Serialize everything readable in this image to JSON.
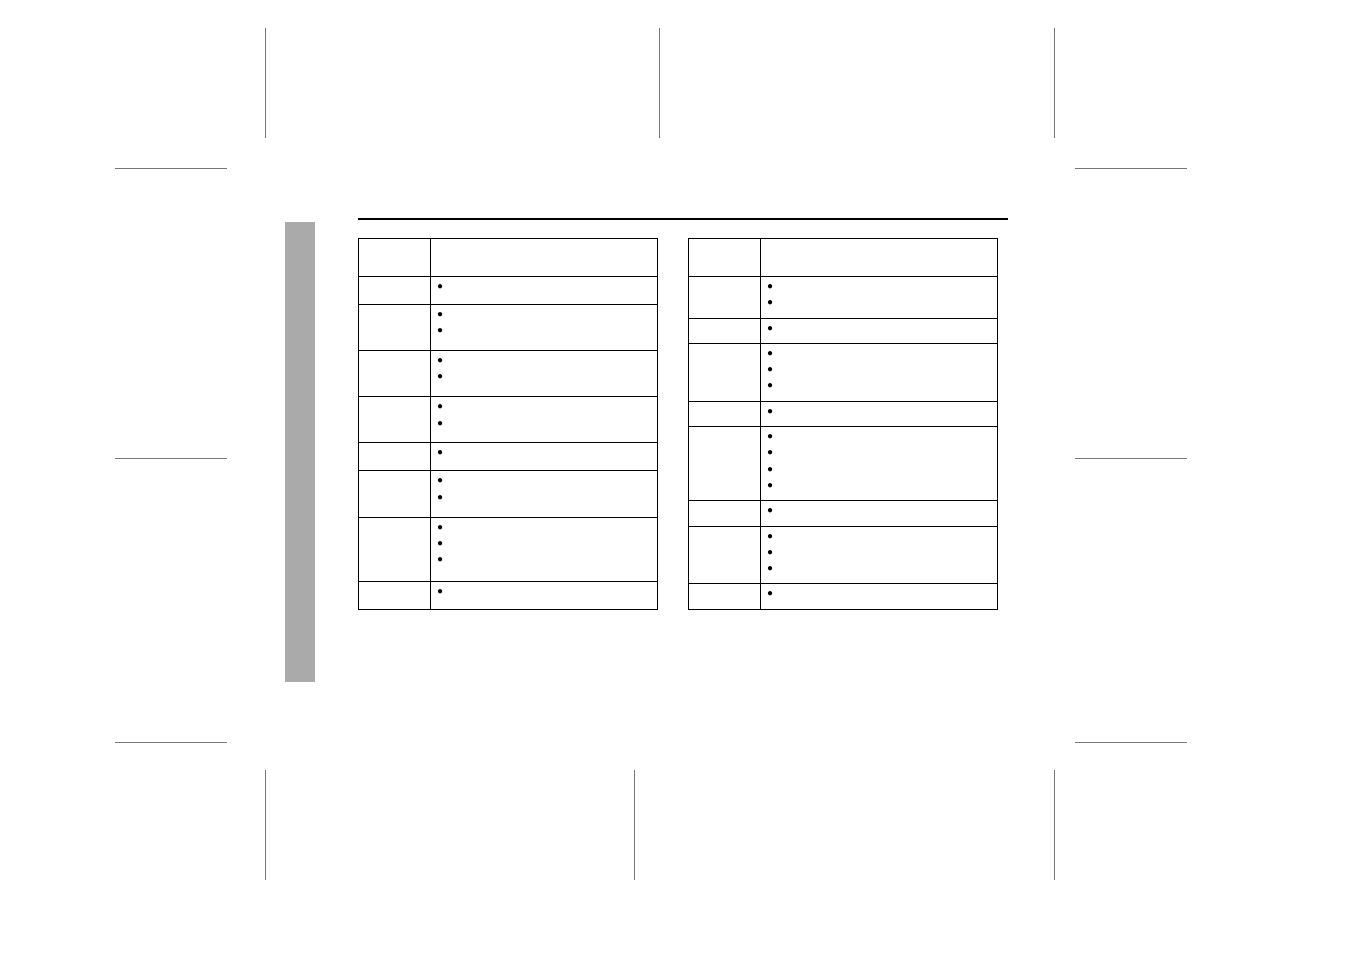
{
  "table1": {
    "rows": [
      {
        "col1": "",
        "bullets": []
      },
      {
        "col1": "",
        "bullets": [
          ""
        ]
      },
      {
        "col1": "",
        "bullets": [
          "",
          ""
        ]
      },
      {
        "col1": "",
        "bullets": [
          "",
          ""
        ]
      },
      {
        "col1": "",
        "bullets": [
          "",
          ""
        ]
      },
      {
        "col1": "",
        "bullets": [
          ""
        ]
      },
      {
        "col1": "",
        "bullets": [
          "",
          ""
        ]
      },
      {
        "col1": "",
        "bullets": [
          "",
          "",
          ""
        ]
      },
      {
        "col1": "",
        "bullets": [
          ""
        ]
      }
    ]
  },
  "table2": {
    "rows": [
      {
        "col1": "",
        "bullets": []
      },
      {
        "col1": "",
        "bullets": [
          "",
          ""
        ]
      },
      {
        "col1": "",
        "bullets": [
          ""
        ]
      },
      {
        "col1": "",
        "bullets": [
          "",
          "",
          ""
        ]
      },
      {
        "col1": "",
        "bullets": [
          ""
        ]
      },
      {
        "col1": "",
        "bullets": [
          "",
          "",
          "",
          ""
        ]
      },
      {
        "col1": "",
        "bullets": [
          ""
        ]
      },
      {
        "col1": "",
        "bullets": [
          "",
          "",
          ""
        ]
      },
      {
        "col1": "",
        "bullets": [
          ""
        ]
      }
    ]
  }
}
